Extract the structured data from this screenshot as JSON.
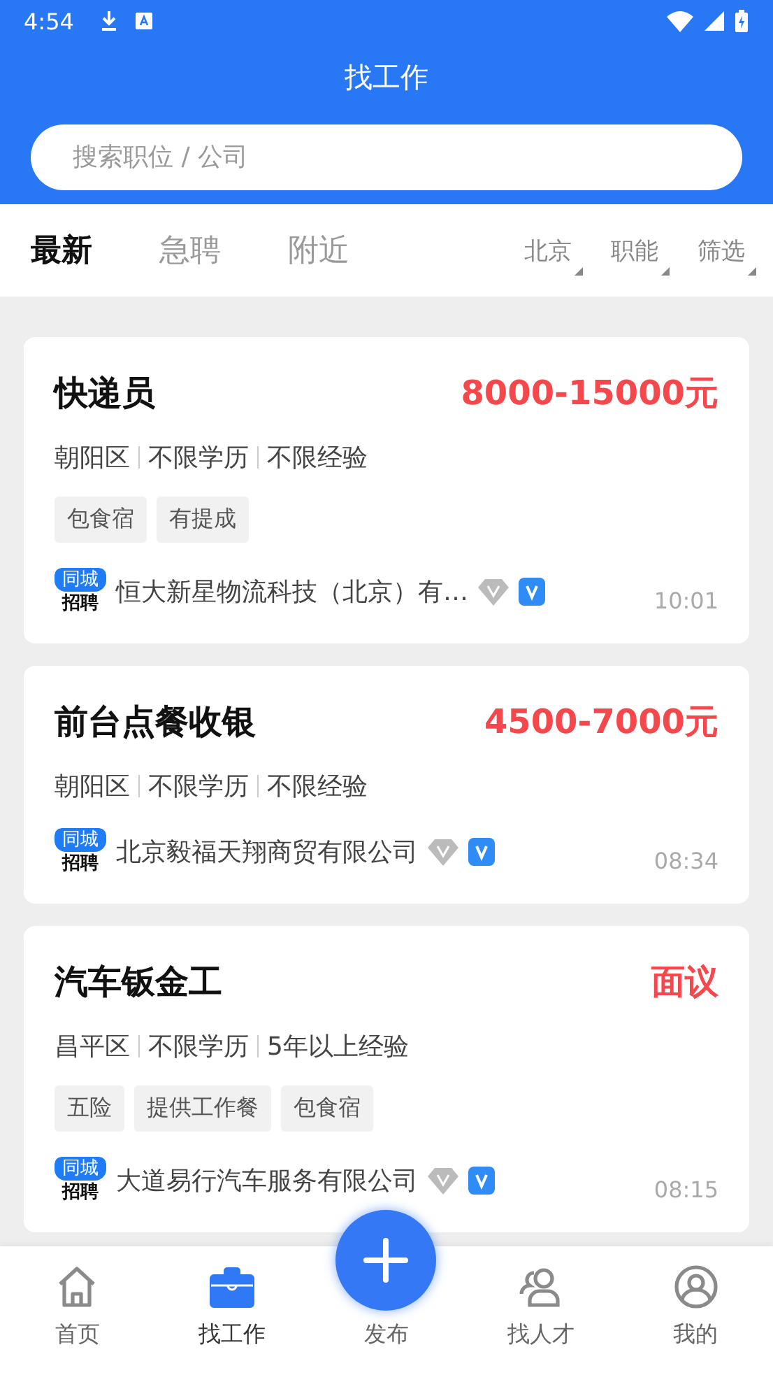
{
  "status_bar": {
    "time": "4:54"
  },
  "header": {
    "title": "找工作"
  },
  "search": {
    "placeholder": "搜索职位 / 公司"
  },
  "tabs": [
    {
      "label": "最新",
      "selected": true
    },
    {
      "label": "急聘",
      "selected": false
    },
    {
      "label": "附近",
      "selected": false
    }
  ],
  "filters": [
    {
      "label": "北京"
    },
    {
      "label": "职能"
    },
    {
      "label": "筛选"
    }
  ],
  "jobs": [
    {
      "title": "快递员",
      "salary": "8000-15000元",
      "meta": [
        "朝阳区",
        "不限学历",
        "不限经验"
      ],
      "tags": [
        "包食宿",
        "有提成"
      ],
      "badge_top": "同城",
      "badge_bottom": "招聘",
      "company": "恒大新星物流科技（北京）有…",
      "time": "10:01"
    },
    {
      "title": "前台点餐收银",
      "salary": "4500-7000元",
      "meta": [
        "朝阳区",
        "不限学历",
        "不限经验"
      ],
      "badge_top": "同城",
      "badge_bottom": "招聘",
      "company": "北京毅福天翔商贸有限公司",
      "time": "08:34"
    },
    {
      "title": "汽车钣金工",
      "salary": "面议",
      "meta": [
        "昌平区",
        "不限学历",
        "5年以上经验"
      ],
      "tags": [
        "五险",
        "提供工作餐",
        "包食宿"
      ],
      "badge_top": "同城",
      "badge_bottom": "招聘",
      "company": "大道易行汽车服务有限公司",
      "time": "08:15"
    }
  ],
  "nav": [
    {
      "label": "首页",
      "kind": "home",
      "selected": false
    },
    {
      "label": "找工作",
      "kind": "jobs",
      "selected": true
    },
    {
      "label": "发布",
      "kind": "publish",
      "selected": false
    },
    {
      "label": "找人才",
      "kind": "talent",
      "selected": false
    },
    {
      "label": "我的",
      "kind": "me",
      "selected": false
    }
  ]
}
